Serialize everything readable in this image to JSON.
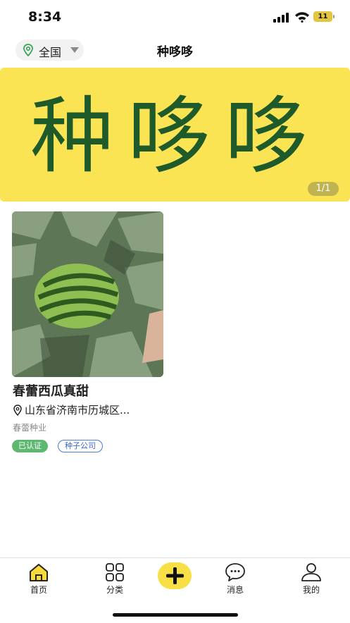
{
  "status_bar": {
    "time": "8:34",
    "battery": "11"
  },
  "header": {
    "location": "全国",
    "title": "种哆哆"
  },
  "banner": {
    "logo_text": "种哆哆",
    "counter": "1/1"
  },
  "listings": [
    {
      "title": "春蕾西瓜真甜",
      "address": "山东省济南市历城区...",
      "company": "春蕾种业",
      "badges": [
        "已认证",
        "种子公司"
      ]
    }
  ],
  "tabbar": {
    "items": [
      {
        "label": "首页",
        "icon": "home-icon"
      },
      {
        "label": "分类",
        "icon": "grid-icon"
      },
      {
        "label": "",
        "icon": "plus-icon"
      },
      {
        "label": "消息",
        "icon": "chat-bubble-icon"
      },
      {
        "label": "我的",
        "icon": "user-icon"
      }
    ]
  },
  "colors": {
    "brand_yellow": "#fae454",
    "logo_green": "#1f5a2b",
    "verified_green": "#5fb872",
    "tag_blue": "#3c68c8"
  }
}
